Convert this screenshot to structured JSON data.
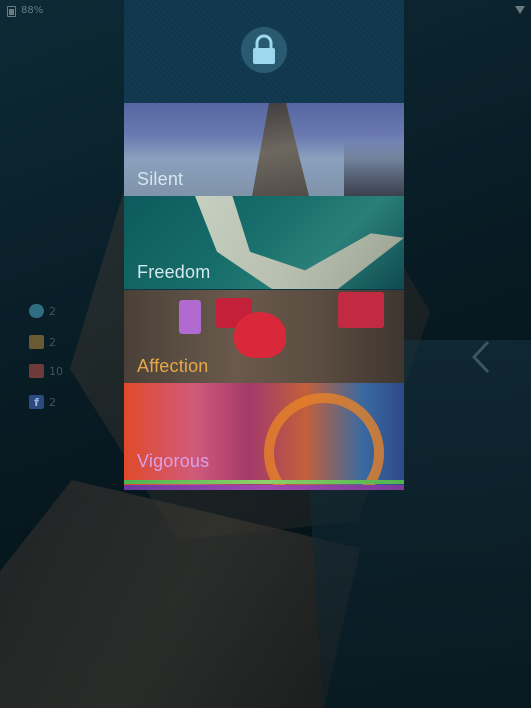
{
  "status_bar": {
    "battery_text": "88%"
  },
  "notifications": [
    {
      "icon": "chat-icon",
      "count": "2"
    },
    {
      "icon": "mail-icon",
      "count": "2"
    },
    {
      "icon": "calendar-icon",
      "count": "10"
    },
    {
      "icon": "facebook-icon",
      "count": "2"
    }
  ],
  "panel": {
    "lock_icon": "lock-icon",
    "ambiences": [
      {
        "label": "Silent",
        "color": "#d4e8f0"
      },
      {
        "label": "Freedom",
        "color": "#d4e8f0"
      },
      {
        "label": "Affection",
        "color": "#e8a84a"
      },
      {
        "label": "Vigorous",
        "color": "#d8a0e8"
      }
    ]
  },
  "colors": {
    "panel_bg": "#0e3448",
    "lock_circle": "#2a5a70",
    "lock_glyph": "#9ed8ef"
  }
}
